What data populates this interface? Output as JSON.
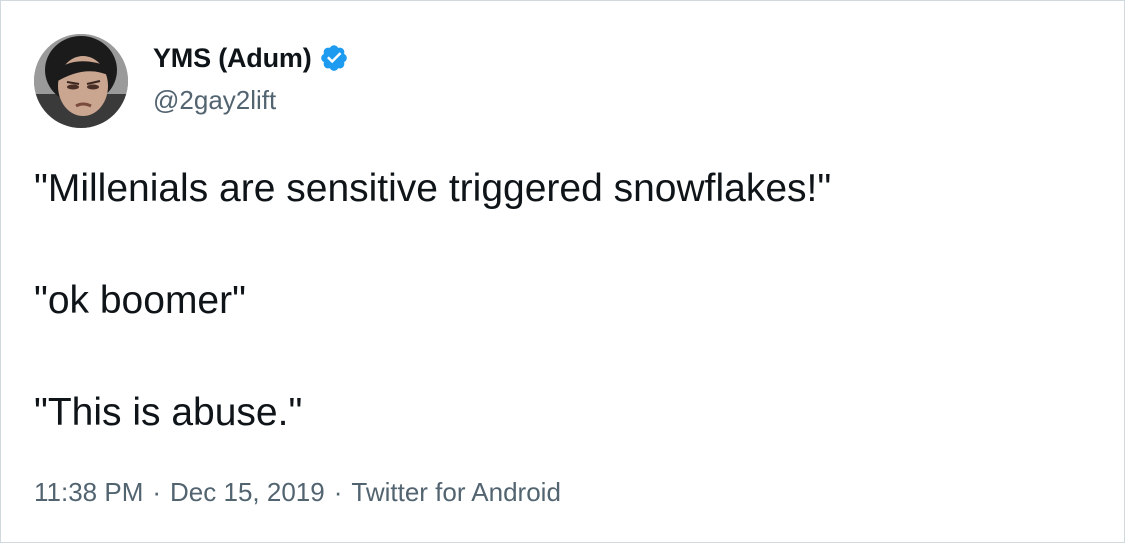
{
  "author": {
    "display_name": "YMS (Adum)",
    "handle": "@2gay2lift",
    "verified_icon": "verified-badge-icon",
    "verified_color": "#1d9bf0"
  },
  "tweet": {
    "lines": [
      "\"Millenials are sensitive triggered snowflakes!\"",
      "\"ok boomer\"",
      "\"This is abuse.\""
    ]
  },
  "meta": {
    "time": "11:38 PM",
    "separator": "·",
    "date": "Dec 15, 2019",
    "source": "Twitter for Android"
  },
  "colors": {
    "text_primary": "#0f1419",
    "text_secondary": "#536471",
    "border": "#cfd9de"
  }
}
